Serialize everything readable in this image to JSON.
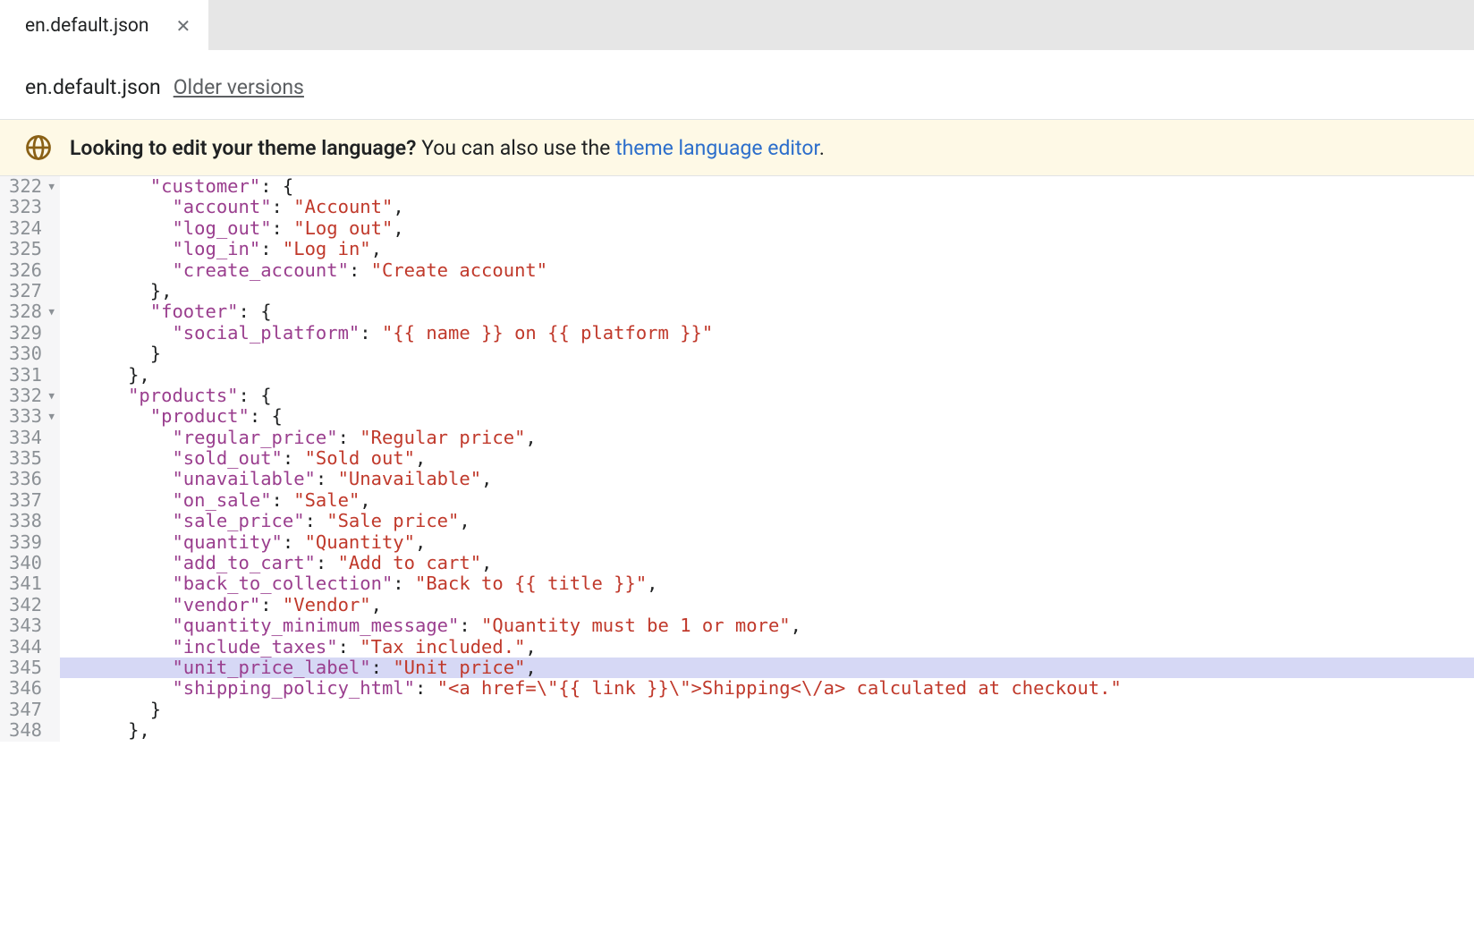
{
  "tab": {
    "label": "en.default.json"
  },
  "subheader": {
    "filename": "en.default.json",
    "older_versions": "Older versions"
  },
  "banner": {
    "bold": "Looking to edit your theme language?",
    "rest": " You can also use the ",
    "link": "theme language editor",
    "period": "."
  },
  "gutter": {
    "start": 322,
    "end": 348,
    "folds": [
      322,
      328,
      332,
      333
    ]
  },
  "code_lines": [
    {
      "i": 4,
      "segs": [
        {
          "t": "\"customer\"",
          "c": "k"
        },
        {
          "t": ": {",
          "c": "p"
        }
      ]
    },
    {
      "i": 5,
      "segs": [
        {
          "t": "\"account\"",
          "c": "k"
        },
        {
          "t": ": ",
          "c": "p"
        },
        {
          "t": "\"Account\"",
          "c": "s"
        },
        {
          "t": ",",
          "c": "p"
        }
      ]
    },
    {
      "i": 5,
      "segs": [
        {
          "t": "\"log_out\"",
          "c": "k"
        },
        {
          "t": ": ",
          "c": "p"
        },
        {
          "t": "\"Log out\"",
          "c": "s"
        },
        {
          "t": ",",
          "c": "p"
        }
      ]
    },
    {
      "i": 5,
      "segs": [
        {
          "t": "\"log_in\"",
          "c": "k"
        },
        {
          "t": ": ",
          "c": "p"
        },
        {
          "t": "\"Log in\"",
          "c": "s"
        },
        {
          "t": ",",
          "c": "p"
        }
      ]
    },
    {
      "i": 5,
      "segs": [
        {
          "t": "\"create_account\"",
          "c": "k"
        },
        {
          "t": ": ",
          "c": "p"
        },
        {
          "t": "\"Create account\"",
          "c": "s"
        }
      ]
    },
    {
      "i": 4,
      "segs": [
        {
          "t": "},",
          "c": "p"
        }
      ]
    },
    {
      "i": 4,
      "segs": [
        {
          "t": "\"footer\"",
          "c": "k"
        },
        {
          "t": ": {",
          "c": "p"
        }
      ]
    },
    {
      "i": 5,
      "segs": [
        {
          "t": "\"social_platform\"",
          "c": "k"
        },
        {
          "t": ": ",
          "c": "p"
        },
        {
          "t": "\"{{ name }} on {{ platform }}\"",
          "c": "s"
        }
      ]
    },
    {
      "i": 4,
      "segs": [
        {
          "t": "}",
          "c": "p"
        }
      ]
    },
    {
      "i": 3,
      "segs": [
        {
          "t": "},",
          "c": "p"
        }
      ]
    },
    {
      "i": 3,
      "segs": [
        {
          "t": "\"products\"",
          "c": "k"
        },
        {
          "t": ": {",
          "c": "p"
        }
      ]
    },
    {
      "i": 4,
      "segs": [
        {
          "t": "\"product\"",
          "c": "k"
        },
        {
          "t": ": {",
          "c": "p"
        }
      ]
    },
    {
      "i": 5,
      "segs": [
        {
          "t": "\"regular_price\"",
          "c": "k"
        },
        {
          "t": ": ",
          "c": "p"
        },
        {
          "t": "\"Regular price\"",
          "c": "s"
        },
        {
          "t": ",",
          "c": "p"
        }
      ]
    },
    {
      "i": 5,
      "segs": [
        {
          "t": "\"sold_out\"",
          "c": "k"
        },
        {
          "t": ": ",
          "c": "p"
        },
        {
          "t": "\"Sold out\"",
          "c": "s"
        },
        {
          "t": ",",
          "c": "p"
        }
      ]
    },
    {
      "i": 5,
      "segs": [
        {
          "t": "\"unavailable\"",
          "c": "k"
        },
        {
          "t": ": ",
          "c": "p"
        },
        {
          "t": "\"Unavailable\"",
          "c": "s"
        },
        {
          "t": ",",
          "c": "p"
        }
      ]
    },
    {
      "i": 5,
      "segs": [
        {
          "t": "\"on_sale\"",
          "c": "k"
        },
        {
          "t": ": ",
          "c": "p"
        },
        {
          "t": "\"Sale\"",
          "c": "s"
        },
        {
          "t": ",",
          "c": "p"
        }
      ]
    },
    {
      "i": 5,
      "segs": [
        {
          "t": "\"sale_price\"",
          "c": "k"
        },
        {
          "t": ": ",
          "c": "p"
        },
        {
          "t": "\"Sale price\"",
          "c": "s"
        },
        {
          "t": ",",
          "c": "p"
        }
      ]
    },
    {
      "i": 5,
      "segs": [
        {
          "t": "\"quantity\"",
          "c": "k"
        },
        {
          "t": ": ",
          "c": "p"
        },
        {
          "t": "\"Quantity\"",
          "c": "s"
        },
        {
          "t": ",",
          "c": "p"
        }
      ]
    },
    {
      "i": 5,
      "segs": [
        {
          "t": "\"add_to_cart\"",
          "c": "k"
        },
        {
          "t": ": ",
          "c": "p"
        },
        {
          "t": "\"Add to cart\"",
          "c": "s"
        },
        {
          "t": ",",
          "c": "p"
        }
      ]
    },
    {
      "i": 5,
      "segs": [
        {
          "t": "\"back_to_collection\"",
          "c": "k"
        },
        {
          "t": ": ",
          "c": "p"
        },
        {
          "t": "\"Back to {{ title }}\"",
          "c": "s"
        },
        {
          "t": ",",
          "c": "p"
        }
      ]
    },
    {
      "i": 5,
      "segs": [
        {
          "t": "\"vendor\"",
          "c": "k"
        },
        {
          "t": ": ",
          "c": "p"
        },
        {
          "t": "\"Vendor\"",
          "c": "s"
        },
        {
          "t": ",",
          "c": "p"
        }
      ]
    },
    {
      "i": 5,
      "segs": [
        {
          "t": "\"quantity_minimum_message\"",
          "c": "k"
        },
        {
          "t": ": ",
          "c": "p"
        },
        {
          "t": "\"Quantity must be 1 or more\"",
          "c": "s"
        },
        {
          "t": ",",
          "c": "p"
        }
      ]
    },
    {
      "i": 5,
      "segs": [
        {
          "t": "\"include_taxes\"",
          "c": "k"
        },
        {
          "t": ": ",
          "c": "p"
        },
        {
          "t": "\"Tax included.\"",
          "c": "s"
        },
        {
          "t": ",",
          "c": "p"
        }
      ]
    },
    {
      "i": 5,
      "hl": true,
      "segs": [
        {
          "t": "\"unit_price_label\"",
          "c": "k"
        },
        {
          "t": ": ",
          "c": "p"
        },
        {
          "t": "\"Unit price\"",
          "c": "s"
        },
        {
          "t": ",",
          "c": "p"
        }
      ]
    },
    {
      "i": 5,
      "segs": [
        {
          "t": "\"shipping_policy_html\"",
          "c": "k"
        },
        {
          "t": ": ",
          "c": "p"
        },
        {
          "t": "\"<a href=\\\"{{ link }}\\\">Shipping<\\/a> calculated at checkout.\"",
          "c": "s"
        }
      ]
    },
    {
      "i": 4,
      "segs": [
        {
          "t": "}",
          "c": "p"
        }
      ]
    },
    {
      "i": 3,
      "segs": [
        {
          "t": "},",
          "c": "p"
        }
      ]
    }
  ]
}
